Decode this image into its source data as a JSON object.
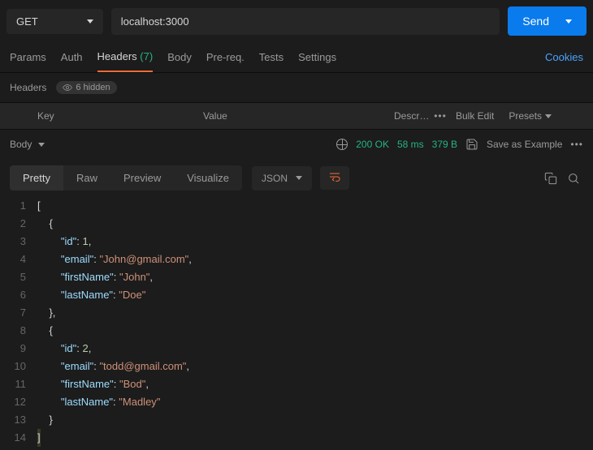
{
  "request": {
    "method": "GET",
    "url": "localhost:3000",
    "send_label": "Send"
  },
  "req_tabs": {
    "items": [
      "Params",
      "Auth",
      "Headers",
      "Body",
      "Pre-req.",
      "Tests",
      "Settings"
    ],
    "active_index": 2,
    "headers_count": "(7)",
    "cookies_label": "Cookies"
  },
  "headers": {
    "label": "Headers",
    "hidden_chip": "6 hidden",
    "cols": {
      "key": "Key",
      "value": "Value",
      "desc": "Description"
    },
    "bulk_edit": "Bulk Edit",
    "presets": "Presets"
  },
  "response": {
    "body_label": "Body",
    "status": "200 OK",
    "time": "58 ms",
    "size": "379 B",
    "save_example": "Save as Example"
  },
  "view": {
    "tabs": [
      "Pretty",
      "Raw",
      "Preview",
      "Visualize"
    ],
    "active_index": 0,
    "lang": "JSON"
  },
  "code_lines": [
    {
      "n": 1,
      "tokens": [
        {
          "t": "["
        }
      ]
    },
    {
      "n": 2,
      "tokens": [
        {
          "t": "    {"
        }
      ]
    },
    {
      "n": 3,
      "tokens": [
        {
          "t": "        "
        },
        {
          "t": "\"id\"",
          "c": "jk"
        },
        {
          "t": ": "
        },
        {
          "t": "1",
          "c": "jn"
        },
        {
          "t": ","
        }
      ]
    },
    {
      "n": 4,
      "tokens": [
        {
          "t": "        "
        },
        {
          "t": "\"email\"",
          "c": "jk"
        },
        {
          "t": ": "
        },
        {
          "t": "\"John@gmail.com\"",
          "c": "js"
        },
        {
          "t": ","
        }
      ]
    },
    {
      "n": 5,
      "tokens": [
        {
          "t": "        "
        },
        {
          "t": "\"firstName\"",
          "c": "jk"
        },
        {
          "t": ": "
        },
        {
          "t": "\"John\"",
          "c": "js"
        },
        {
          "t": ","
        }
      ]
    },
    {
      "n": 6,
      "tokens": [
        {
          "t": "        "
        },
        {
          "t": "\"lastName\"",
          "c": "jk"
        },
        {
          "t": ": "
        },
        {
          "t": "\"Doe\"",
          "c": "js"
        }
      ]
    },
    {
      "n": 7,
      "tokens": [
        {
          "t": "    },"
        }
      ]
    },
    {
      "n": 8,
      "tokens": [
        {
          "t": "    {"
        }
      ]
    },
    {
      "n": 9,
      "tokens": [
        {
          "t": "        "
        },
        {
          "t": "\"id\"",
          "c": "jk"
        },
        {
          "t": ": "
        },
        {
          "t": "2",
          "c": "jn"
        },
        {
          "t": ","
        }
      ]
    },
    {
      "n": 10,
      "tokens": [
        {
          "t": "        "
        },
        {
          "t": "\"email\"",
          "c": "jk"
        },
        {
          "t": ": "
        },
        {
          "t": "\"todd@gmail.com\"",
          "c": "js"
        },
        {
          "t": ","
        }
      ]
    },
    {
      "n": 11,
      "tokens": [
        {
          "t": "        "
        },
        {
          "t": "\"firstName\"",
          "c": "jk"
        },
        {
          "t": ": "
        },
        {
          "t": "\"Bod\"",
          "c": "js"
        },
        {
          "t": ","
        }
      ]
    },
    {
      "n": 12,
      "tokens": [
        {
          "t": "        "
        },
        {
          "t": "\"lastName\"",
          "c": "jk"
        },
        {
          "t": ": "
        },
        {
          "t": "\"Madley\"",
          "c": "js"
        }
      ]
    },
    {
      "n": 13,
      "tokens": [
        {
          "t": "    }"
        }
      ]
    },
    {
      "n": 14,
      "hl": true,
      "tokens": [
        {
          "t": "]"
        }
      ]
    }
  ]
}
